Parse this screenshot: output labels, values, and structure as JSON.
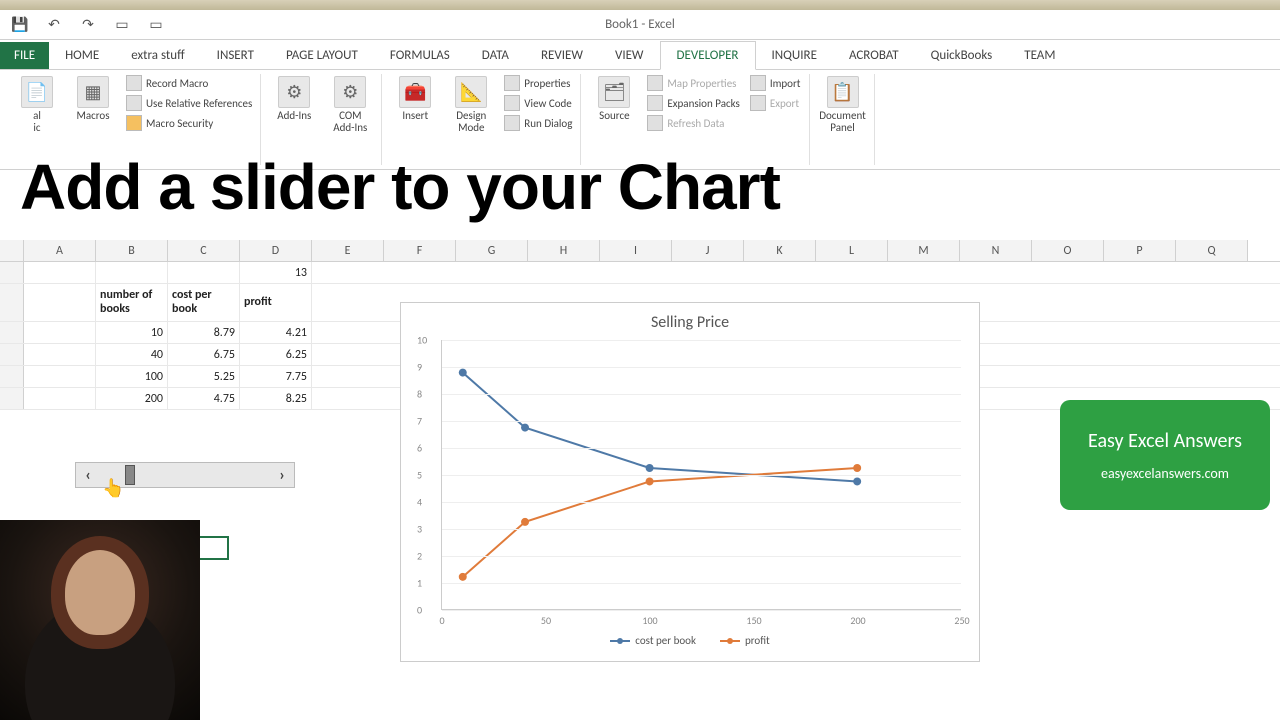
{
  "window_title": "Book1 - Excel",
  "tabs": {
    "file": "FILE",
    "items": [
      "HOME",
      "extra stuff",
      "INSERT",
      "PAGE LAYOUT",
      "FORMULAS",
      "DATA",
      "REVIEW",
      "VIEW",
      "DEVELOPER",
      "INQUIRE",
      "ACROBAT",
      "QuickBooks",
      "TEAM"
    ],
    "active": "DEVELOPER"
  },
  "ribbon": {
    "macros": "Macros",
    "record_macro": "Record Macro",
    "use_relative": "Use Relative References",
    "macro_security": "Macro Security",
    "addins": "Add-Ins",
    "com_addins": "COM Add-Ins",
    "insert": "Insert",
    "design_mode": "Design Mode",
    "properties": "Properties",
    "view_code": "View Code",
    "run_dialog": "Run Dialog",
    "source": "Source",
    "map_properties": "Map Properties",
    "expansion_packs": "Expansion Packs",
    "refresh_data": "Refresh Data",
    "import": "Import",
    "export": "Export",
    "document_panel": "Document Panel"
  },
  "overlay_title": "Add a slider to your Chart",
  "columns": [
    "A",
    "B",
    "C",
    "D",
    "E",
    "F",
    "G",
    "H",
    "I",
    "J",
    "K",
    "L",
    "M",
    "N",
    "O",
    "P",
    "Q"
  ],
  "data_table": {
    "d1": "13",
    "headers": {
      "b": "number of books",
      "c": "cost per book",
      "d": "profit"
    },
    "rows": [
      {
        "b": "10",
        "c": "8.79",
        "d": "4.21"
      },
      {
        "b": "40",
        "c": "6.75",
        "d": "6.25"
      },
      {
        "b": "100",
        "c": "5.25",
        "d": "7.75"
      },
      {
        "b": "200",
        "c": "4.75",
        "d": "8.25"
      }
    ]
  },
  "chart_data": {
    "type": "line",
    "title": "Selling Price",
    "x": [
      10,
      40,
      100,
      200
    ],
    "series": [
      {
        "name": "cost per book",
        "values": [
          8.79,
          6.75,
          5.25,
          4.75
        ],
        "color": "#4e79a7"
      },
      {
        "name": "profit",
        "values": [
          1.21,
          3.25,
          4.75,
          5.25
        ],
        "color": "#e07b3a"
      }
    ],
    "xlim": [
      0,
      250
    ],
    "ylim": [
      0,
      10
    ],
    "xticks": [
      0,
      50,
      100,
      150,
      200,
      250
    ],
    "yticks": [
      0,
      1,
      2,
      3,
      4,
      5,
      6,
      7,
      8,
      9,
      10
    ]
  },
  "badge": {
    "l1": "Easy Excel Answers",
    "l2": "easyexcelanswers.com"
  },
  "colors": {
    "series1": "#4e79a7",
    "series2": "#e07b3a",
    "accent": "#217346"
  }
}
